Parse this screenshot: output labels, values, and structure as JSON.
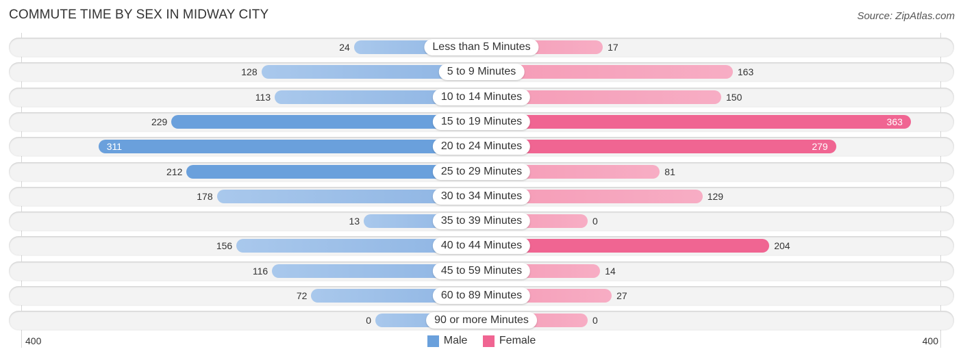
{
  "chart_data": {
    "type": "bar",
    "orientation": "horizontal-diverging",
    "title": "COMMUTE TIME BY SEX IN MIDWAY CITY",
    "source": "Source: ZipAtlas.com",
    "categories": [
      "Less than 5 Minutes",
      "5 to 9 Minutes",
      "10 to 14 Minutes",
      "15 to 19 Minutes",
      "20 to 24 Minutes",
      "25 to 29 Minutes",
      "30 to 34 Minutes",
      "35 to 39 Minutes",
      "40 to 44 Minutes",
      "45 to 59 Minutes",
      "60 to 89 Minutes",
      "90 or more Minutes"
    ],
    "series": [
      {
        "name": "Male",
        "color": "#6aa0dc",
        "values": [
          24,
          128,
          113,
          229,
          311,
          212,
          178,
          13,
          156,
          116,
          72,
          0
        ]
      },
      {
        "name": "Female",
        "color": "#f06592",
        "values": [
          17,
          163,
          150,
          363,
          279,
          81,
          129,
          0,
          204,
          14,
          27,
          0
        ]
      }
    ],
    "axis": {
      "left_label": "400",
      "right_label": "400",
      "range": [
        0,
        400
      ]
    },
    "legend": {
      "position": "bottom-center",
      "items": [
        "Male",
        "Female"
      ]
    }
  }
}
